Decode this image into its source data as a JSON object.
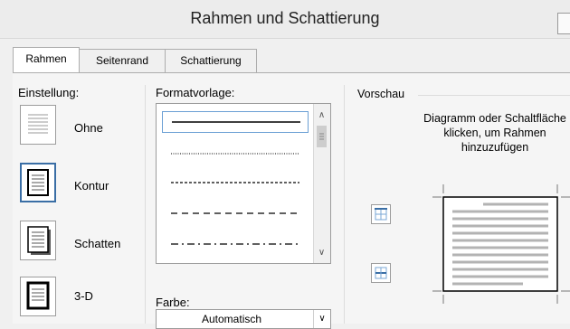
{
  "window": {
    "title": "Rahmen und Schattierung"
  },
  "tabs": [
    {
      "label": "Rahmen",
      "active": true
    },
    {
      "label": "Seitenrand",
      "active": false
    },
    {
      "label": "Schattierung",
      "active": false
    }
  ],
  "settings": {
    "heading": "Einstellung:",
    "options": [
      {
        "label": "Ohne",
        "selected": false
      },
      {
        "label": "Kontur",
        "selected": true
      },
      {
        "label": "Schatten",
        "selected": false
      },
      {
        "label": "3-D",
        "selected": false
      }
    ]
  },
  "style": {
    "heading": "Formatvorlage:",
    "items": [
      "solid",
      "dotted",
      "dashed-fine",
      "dashed",
      "dash-dot"
    ],
    "selected_index": 0
  },
  "color": {
    "heading": "Farbe:",
    "value": "Automatisch"
  },
  "preview": {
    "heading": "Vorschau",
    "hint_line1": "Diagramm oder Schaltfläche",
    "hint_line2": "klicken, um Rahmen",
    "hint_line3": "hinzuzufügen"
  },
  "colors": {
    "accent": "#3a6ea5",
    "select_border": "#6a9fd4",
    "border": "#9c9c9c"
  }
}
